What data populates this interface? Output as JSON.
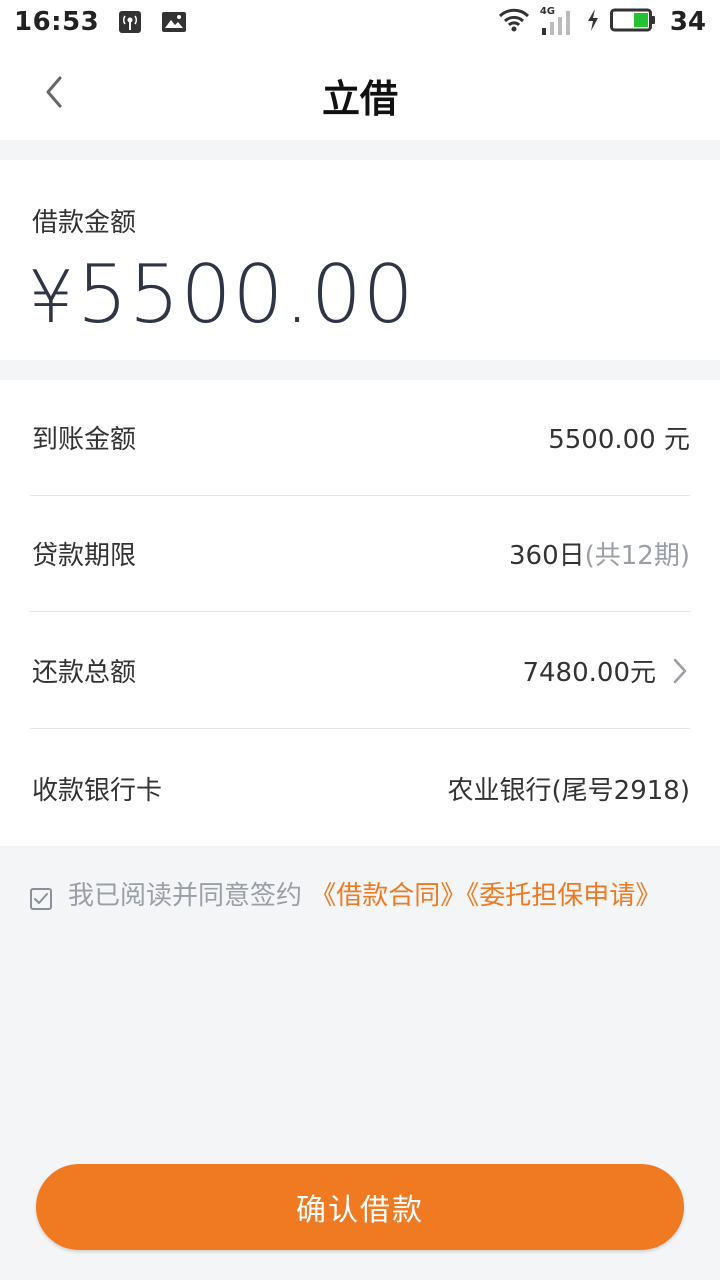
{
  "status_bar": {
    "time": "16:53",
    "network": "4G",
    "battery": "34",
    "icons": [
      "signal-tower-icon",
      "image-icon",
      "wifi-icon",
      "cellular-signal-icon",
      "charging-icon",
      "battery-icon"
    ]
  },
  "header": {
    "title": "立借",
    "back_icon": "chevron-left-icon"
  },
  "loan_amount": {
    "label": "借款金额",
    "currency": "¥",
    "value": "5500.00"
  },
  "details": [
    {
      "label": "到账金额",
      "value": "5500.00 元",
      "note": ""
    },
    {
      "label": "贷款期限",
      "value": "360日",
      "note": "(共12期)"
    },
    {
      "label": "还款总额",
      "value": "7480.00元",
      "note": "",
      "chevron": true
    },
    {
      "label": "收款银行卡",
      "value": "农业银行(尾号2918)",
      "note": ""
    }
  ],
  "agreement": {
    "checked": true,
    "text": "我已阅读并同意签约 ",
    "link1": "《借款合同》",
    "link2": "《委托担保申请》"
  },
  "confirm_button": {
    "label": "确认借款"
  },
  "colors": {
    "accent": "#f07a22",
    "page_bg": "#f3f5f6",
    "amount_text": "#2f3446",
    "muted_text": "#9a9ea6"
  }
}
